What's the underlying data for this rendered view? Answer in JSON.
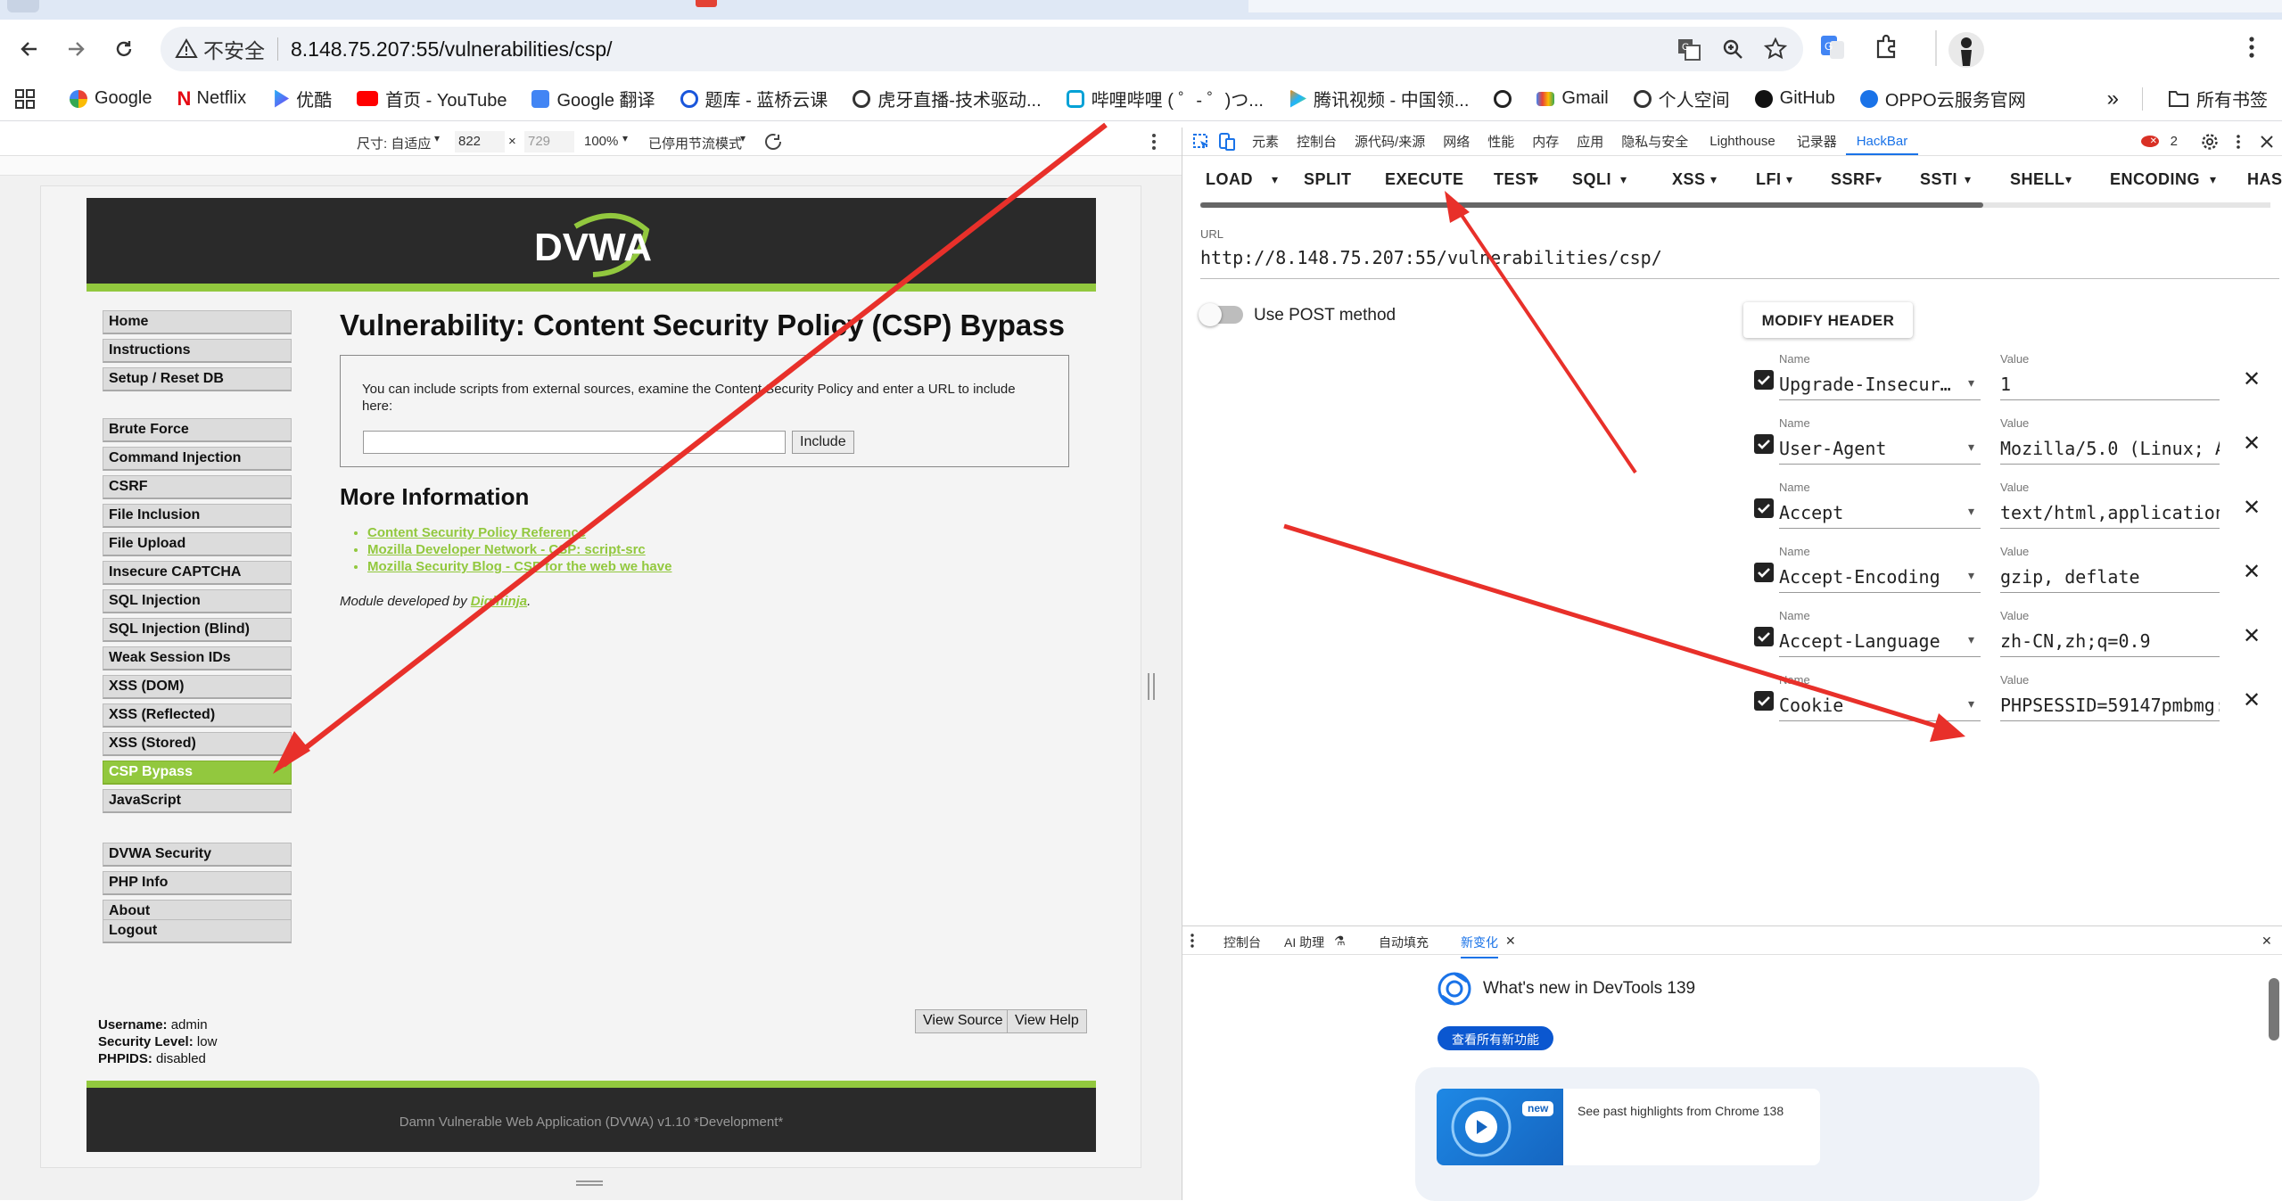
{
  "browser": {
    "url_warning": "不安全",
    "url": "8.148.75.207:55/vulnerabilities/csp/",
    "bookmarks": [
      "Google",
      "Netflix",
      "优酷",
      "首页 - YouTube",
      "Google 翻译",
      "题库 - 蓝桥云课",
      "虎牙直播-技术驱动...",
      "哔哩哔哩 ( ゜- ゜)つ...",
      "腾讯视频 - 中国领...",
      "",
      "Gmail",
      "个人空间",
      "GitHub",
      "OPPO云服务官网"
    ],
    "bookmark_more": "»",
    "all_bookmarks": "所有书签",
    "colors": {
      "accent": "#1a73e8",
      "tabstrip": "#dfe8f5"
    }
  },
  "emulation": {
    "size_label": "尺寸: 自适应",
    "width": "822",
    "times": "×",
    "height": "729",
    "zoom": "100%",
    "throttle": "已停用节流模式"
  },
  "dvwa": {
    "logo": "DVWA",
    "title": "Vulnerability: Content Security Policy (CSP) Bypass",
    "instructions": "You can include scripts from external sources, examine the Content Security Policy and enter a URL to include here:",
    "include_button": "Include",
    "more_info": "More Information",
    "links": [
      "Content Security Policy Reference",
      "Mozilla Developer Network - CSP: script-src",
      "Mozilla Security Blog - CSP for the web we have"
    ],
    "developer_prefix": "Module developed by ",
    "developer": "Digininja",
    "developer_suffix": ".",
    "menu_group1": [
      "Home",
      "Instructions",
      "Setup / Reset DB"
    ],
    "menu_group2": [
      "Brute Force",
      "Command Injection",
      "CSRF",
      "File Inclusion",
      "File Upload",
      "Insecure CAPTCHA",
      "SQL Injection",
      "SQL Injection (Blind)",
      "Weak Session IDs",
      "XSS (DOM)",
      "XSS (Reflected)",
      "XSS (Stored)",
      "CSP Bypass",
      "JavaScript"
    ],
    "menu_group3": [
      "DVWA Security",
      "PHP Info",
      "About"
    ],
    "menu_group4": [
      "Logout"
    ],
    "active_item": "CSP Bypass",
    "username_label": "Username:",
    "username": "admin",
    "security_label": "Security Level:",
    "security": "low",
    "phpids_label": "PHPIDS:",
    "phpids": "disabled",
    "view_source": "View Source",
    "view_help": "View Help",
    "footer": "Damn Vulnerable Web Application (DVWA) v1.10 *Development*",
    "colors": {
      "green": "#92c83e",
      "dark": "#2a2a2a"
    }
  },
  "devtools": {
    "tabs": [
      "元素",
      "控制台",
      "源代码/来源",
      "网络",
      "性能",
      "内存",
      "应用",
      "隐私与安全",
      "Lighthouse",
      "记录器",
      "HackBar"
    ],
    "active_tab": "HackBar",
    "error_count": "2",
    "hackbar": {
      "menu": [
        "LOAD",
        "SPLIT",
        "EXECUTE",
        "TEST",
        "SQLI",
        "XSS",
        "LFI",
        "SSRF",
        "SSTI",
        "SHELL",
        "ENCODING",
        "HAS"
      ],
      "dropdown_items": [
        "TEST",
        "SQLI",
        "XSS",
        "LFI",
        "SSRF",
        "SSTI",
        "SHELL",
        "ENCODING"
      ],
      "url_label": "URL",
      "url_value": "http://8.148.75.207:55/vulnerabilities/csp/",
      "post_label": "Use POST method",
      "modify_header": "MODIFY HEADER",
      "name_label": "Name",
      "value_label": "Value",
      "headers": [
        {
          "name": "Upgrade-Insecur…",
          "value": "1"
        },
        {
          "name": "User-Agent",
          "value": "Mozilla/5.0 (Linux; A"
        },
        {
          "name": "Accept",
          "value": "text/html,application"
        },
        {
          "name": "Accept-Encoding",
          "value": "gzip, deflate"
        },
        {
          "name": "Accept-Language",
          "value": "zh-CN,zh;q=0.9"
        },
        {
          "name": "Cookie",
          "value": "PHPSESSID=59147pmbmg:"
        }
      ]
    },
    "drawer": {
      "tabs": [
        "控制台",
        "AI 助理",
        "自动填充",
        "新变化"
      ],
      "active_tab": "新变化",
      "whats_new": "What's new in DevTools 139",
      "see_all": "查看所有新功能",
      "new_badge": "new",
      "highlights": "See past highlights from Chrome 138"
    }
  }
}
